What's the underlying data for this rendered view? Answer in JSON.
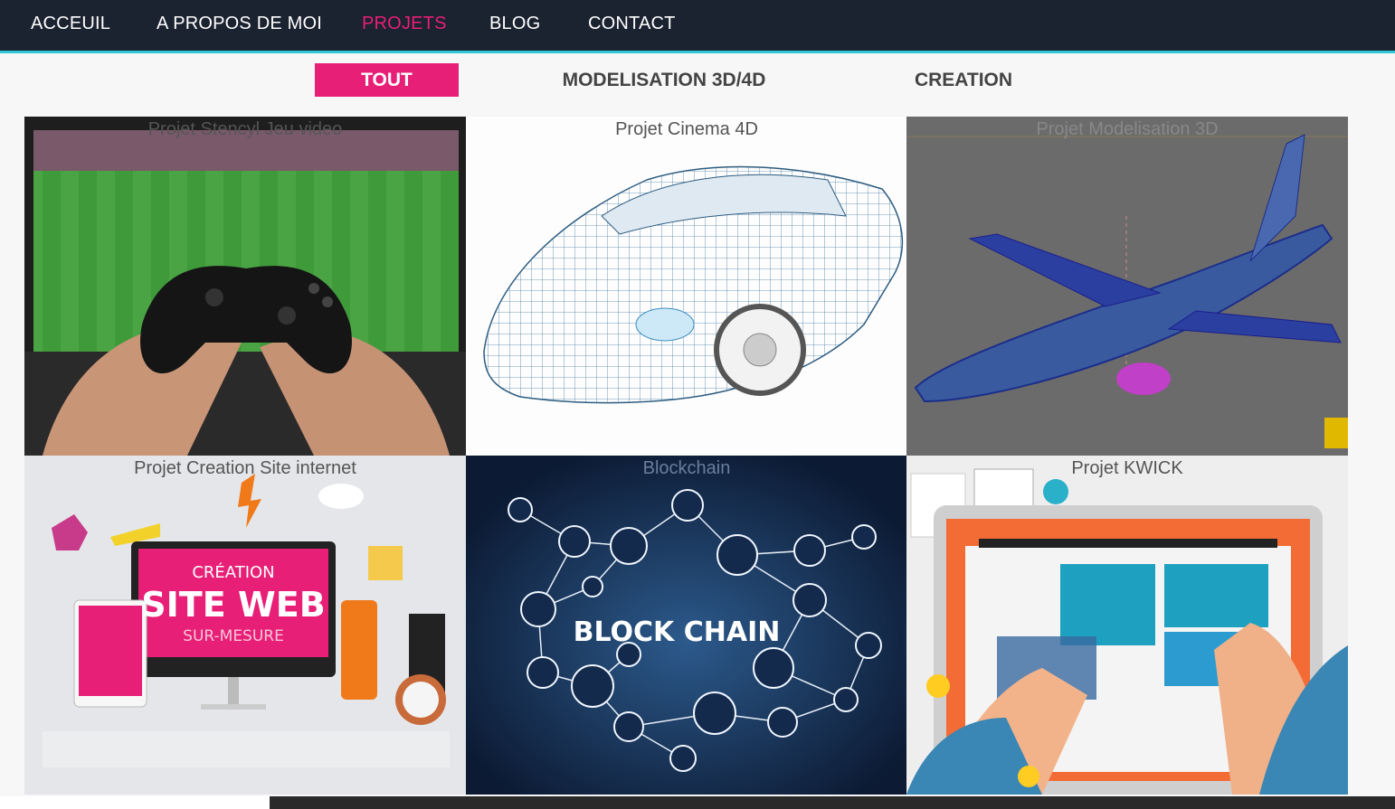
{
  "nav": {
    "items": [
      {
        "label": "ACCEUIL",
        "active": false
      },
      {
        "label": "A PROPOS DE MOI",
        "active": false
      },
      {
        "label": "PROJETS",
        "active": true
      },
      {
        "label": "BLOG",
        "active": false
      },
      {
        "label": "CONTACT",
        "active": false
      }
    ]
  },
  "filters": [
    {
      "label": "TOUT",
      "active": true
    },
    {
      "label": "MODELISATION 3D/4D",
      "active": false
    },
    {
      "label": "CREATION",
      "active": false
    }
  ],
  "projects": [
    {
      "caption": "Projet Stencyl Jeu video",
      "image": "game-controller-photo"
    },
    {
      "caption": "Projet Cinema 4D",
      "image": "wireframe-car"
    },
    {
      "caption": "Projet Modelisation 3D",
      "image": "wireframe-airplane"
    },
    {
      "caption": "Projet Creation Site internet",
      "image": "website-creation-illustration"
    },
    {
      "caption": "Blockchain",
      "image": "blockchain-network"
    },
    {
      "caption": "Projet KWICK",
      "image": "web-design-illustration"
    }
  ],
  "artwork": {
    "site_web_top": "CRÉATION",
    "site_web_main": "SITE WEB",
    "site_web_bottom": "SUR-MESURE",
    "blockchain_text": "BLOCK CHAIN"
  }
}
